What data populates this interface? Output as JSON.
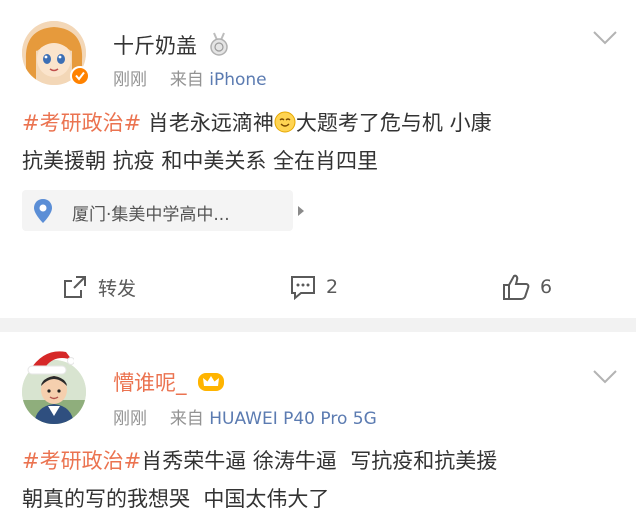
{
  "post1": {
    "username": "十斤奶盖",
    "time": "刚刚",
    "source_prefix": "来自",
    "source": "iPhone",
    "hashtag": "#考研政治#",
    "text_a": "肖老永远滴神",
    "text_b": "大题考了危与机 小康",
    "text_line2": "抗美援朝 抗疫 和中美关系 全在肖四里",
    "location": "厦门·集美中学高中...",
    "actions": {
      "repost": "转发",
      "comments": "2",
      "likes": "6"
    }
  },
  "post2": {
    "username": "懵谁呢_",
    "time": "刚刚",
    "source_prefix": "来自",
    "source": "HUAWEI P40 Pro 5G",
    "hashtag": "#考研政治#",
    "text_a": "肖秀荣牛逼 徐涛牛逼  写抗疫和抗美援",
    "text_line2": "朝真的写的我想哭  中国太伟大了"
  },
  "colors": {
    "hashtag": "#eb7350",
    "accent": "#ff8200",
    "source_link": "#5b7bb1"
  },
  "icons": [
    "medal-icon",
    "verified-badge-icon",
    "crown-badge-icon",
    "chevron-down-icon",
    "location-pin-icon",
    "share-icon",
    "comment-icon",
    "like-icon",
    "emoji-icon"
  ]
}
